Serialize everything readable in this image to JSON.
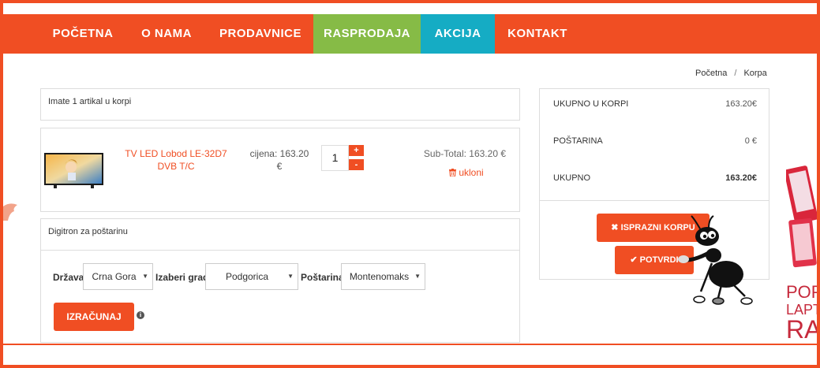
{
  "nav": {
    "items": [
      {
        "label": "POČETNA"
      },
      {
        "label": "O NAMA"
      },
      {
        "label": "PRODAVNICE"
      },
      {
        "label": "RASPRODAJA"
      },
      {
        "label": "AKCIJA"
      },
      {
        "label": "KONTAKT"
      }
    ]
  },
  "breadcrumb": {
    "home": "Početna",
    "sep": "/",
    "current": "Korpa"
  },
  "cart": {
    "count_text": "Imate 1 artikal u korpi",
    "item": {
      "name": "TV LED Lobod LE-32D7 DVB T/C",
      "price": "cijena: 163.20 €",
      "quantity": "1",
      "plus": "+",
      "minus": "-",
      "subtotal": "Sub-Total: 163.20 €",
      "remove": "ukloni"
    }
  },
  "shipping": {
    "title": "Digitron za poštarinu",
    "country_label": "Država",
    "country_value": "Crna Gora",
    "city_label": "Izaberi grad",
    "city_value": "Podgorica",
    "post_label": "Poštarina",
    "post_value": "Montenomaks",
    "calc_button": "IZRAČUNAJ",
    "info": "i"
  },
  "summary": {
    "rows": [
      {
        "label": "UKUPNO U KORPI",
        "value": "163.20€"
      },
      {
        "label": "POŠTARINA",
        "value": "0 €"
      },
      {
        "label": "UKUPNO",
        "value": "163.20€"
      }
    ],
    "empty_button": "✖ ISPRAZNI KORPU",
    "confirm_button": "✔ POTVRDI"
  },
  "promo": {
    "line1": "POP",
    "line2": "LAPT",
    "line3": "RA"
  },
  "colors": {
    "accent": "#f04e23",
    "green": "#86bb46",
    "blue": "#15acc4",
    "promo": "#c62a3c"
  }
}
